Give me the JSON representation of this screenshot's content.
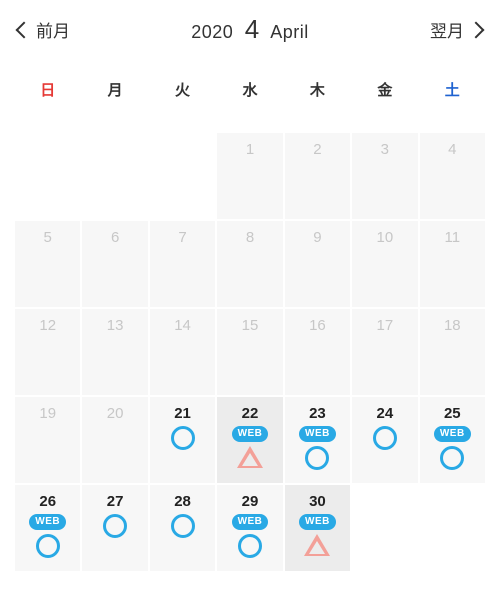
{
  "nav": {
    "prev_label": "前月",
    "next_label": "翌月",
    "year": "2020",
    "month_num": "4",
    "month_name": "April"
  },
  "weekdays": [
    {
      "label": "日",
      "cls": "sun"
    },
    {
      "label": "月",
      "cls": ""
    },
    {
      "label": "火",
      "cls": ""
    },
    {
      "label": "水",
      "cls": ""
    },
    {
      "label": "木",
      "cls": ""
    },
    {
      "label": "金",
      "cls": ""
    },
    {
      "label": "土",
      "cls": "sat"
    }
  ],
  "badge_text": "WEB",
  "cells": [
    {
      "n": "",
      "state": "blank"
    },
    {
      "n": "",
      "state": "blank"
    },
    {
      "n": "",
      "state": "blank"
    },
    {
      "n": "1",
      "state": "disabled"
    },
    {
      "n": "2",
      "state": "disabled"
    },
    {
      "n": "3",
      "state": "disabled"
    },
    {
      "n": "4",
      "state": "disabled"
    },
    {
      "n": "5",
      "state": "disabled"
    },
    {
      "n": "6",
      "state": "disabled"
    },
    {
      "n": "7",
      "state": "disabled"
    },
    {
      "n": "8",
      "state": "disabled"
    },
    {
      "n": "9",
      "state": "disabled"
    },
    {
      "n": "10",
      "state": "disabled"
    },
    {
      "n": "11",
      "state": "disabled"
    },
    {
      "n": "12",
      "state": "disabled"
    },
    {
      "n": "13",
      "state": "disabled"
    },
    {
      "n": "14",
      "state": "disabled"
    },
    {
      "n": "15",
      "state": "disabled"
    },
    {
      "n": "16",
      "state": "disabled"
    },
    {
      "n": "17",
      "state": "disabled"
    },
    {
      "n": "18",
      "state": "disabled"
    },
    {
      "n": "19",
      "state": "disabled"
    },
    {
      "n": "20",
      "state": "disabled"
    },
    {
      "n": "21",
      "state": "active",
      "marks": [
        "circle"
      ]
    },
    {
      "n": "22",
      "state": "today",
      "marks": [
        "web",
        "triangle"
      ]
    },
    {
      "n": "23",
      "state": "active",
      "marks": [
        "web",
        "circle"
      ]
    },
    {
      "n": "24",
      "state": "active",
      "marks": [
        "circle"
      ]
    },
    {
      "n": "25",
      "state": "active",
      "marks": [
        "web",
        "circle"
      ]
    },
    {
      "n": "26",
      "state": "active",
      "marks": [
        "web",
        "circle"
      ]
    },
    {
      "n": "27",
      "state": "active",
      "marks": [
        "circle"
      ]
    },
    {
      "n": "28",
      "state": "active",
      "marks": [
        "circle"
      ]
    },
    {
      "n": "29",
      "state": "active",
      "marks": [
        "web",
        "circle"
      ]
    },
    {
      "n": "30",
      "state": "today",
      "marks": [
        "web",
        "triangle"
      ]
    },
    {
      "n": "",
      "state": "blank"
    },
    {
      "n": "",
      "state": "blank"
    }
  ]
}
